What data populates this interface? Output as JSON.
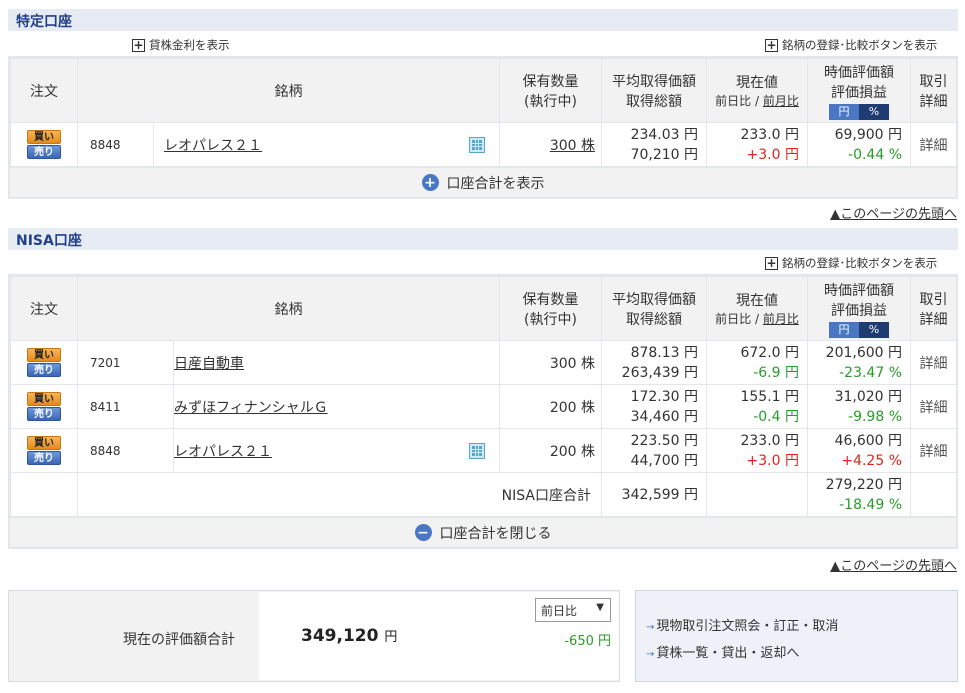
{
  "tokutei": {
    "title": "特定口座",
    "show_lending_rate": "貸株金利を表示",
    "register_compare": "銘柄の登録･比較ボタンを表示",
    "show_total": "口座合計を表示"
  },
  "nisa": {
    "title": "NISA口座",
    "register_compare": "銘柄の登録･比較ボタンを表示",
    "total_label": "NISA口座合計",
    "total_cost": "342,599 円",
    "total_value": "279,220 円",
    "total_pct": "-18.49 %",
    "close_total": "口座合計を閉じる"
  },
  "headers": {
    "order": "注文",
    "stock": "銘柄",
    "qty_1": "保有数量",
    "qty_2": "(執行中)",
    "avg_1": "平均取得価額",
    "avg_2": "取得総額",
    "price": "現在値",
    "price_sub_1": "前日比",
    "price_sub_sep": " / ",
    "price_sub_2": "前月比",
    "eval_1": "時価評価額",
    "eval_2": "評価損益",
    "toggle_yen": "円",
    "toggle_pct": "%",
    "detail_1": "取引",
    "detail_2": "詳細"
  },
  "buttons": {
    "buy": "買い",
    "sell": "売り",
    "detail": "詳細"
  },
  "tokutei_rows": [
    {
      "code": "8848",
      "name": "レオパレス２１",
      "qty": "300 株",
      "avg": "234.03 円",
      "cost": "70,210 円",
      "price": "233.0 円",
      "change": "+3.0 円",
      "value": "69,900 円",
      "pct": "-0.44 %"
    }
  ],
  "nisa_rows": [
    {
      "code": "7201",
      "name": "日産自動車",
      "qty": "300 株",
      "avg": "878.13 円",
      "cost": "263,439 円",
      "price": "672.0 円",
      "change": "-6.9 円",
      "value": "201,600 円",
      "pct": "-23.47 %"
    },
    {
      "code": "8411",
      "name": "みずほフィナンシャルＧ",
      "qty": "200 株",
      "avg": "172.30 円",
      "cost": "34,460 円",
      "price": "155.1 円",
      "change": "-0.4 円",
      "value": "31,020 円",
      "pct": "-9.98 %"
    },
    {
      "code": "8848",
      "name": "レオパレス２１",
      "qty": "200 株",
      "avg": "223.50 円",
      "cost": "44,700 円",
      "price": "233.0 円",
      "change": "+3.0 円",
      "value": "46,600 円",
      "pct": "+4.25 %"
    }
  ],
  "page_top": "▲このページの先頭へ",
  "summary": {
    "label": "現在の評価額合計",
    "value": "349,120",
    "unit": "円",
    "select_value": "前日比",
    "change": "-650 円"
  },
  "links": {
    "order_inquiry": "現物取引注文照会・訂正・取消",
    "lending_list": "貸株一覧・貸出・返却へ"
  },
  "colors": {
    "header_bg": "#e6ebf4",
    "header_text": "#22418a",
    "plus": "#e2231a",
    "minus": "#2a9b2a",
    "accent": "#4a77c4"
  }
}
